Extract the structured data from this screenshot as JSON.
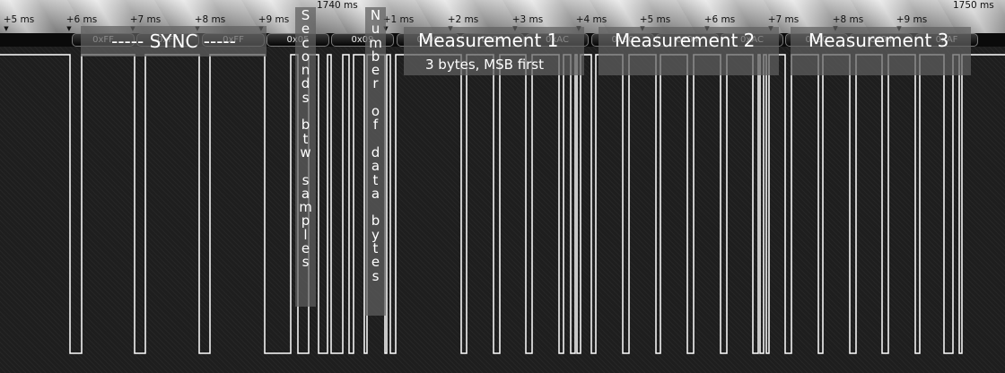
{
  "timeline": {
    "center_label": "1740 ms",
    "right_label": "1750 ms",
    "ticks": [
      "+5 ms",
      "+6 ms",
      "+7 ms",
      "+8 ms",
      "+9 ms",
      "+1 ms",
      "+2 ms",
      "+3 ms",
      "+4 ms",
      "+5 ms",
      "+6 ms",
      "+7 ms",
      "+8 ms",
      "+9 ms"
    ]
  },
  "decoded_bytes": [
    "0xFF",
    "0xFF",
    "0xFF",
    "0x05",
    "0x09",
    "0x00",
    "0x04",
    "0xAC",
    "0x00",
    "0x04",
    "0xAC",
    "0x00",
    "0x04",
    "0xAF"
  ],
  "annotations": {
    "sync": "----- SYNC -----",
    "seconds": [
      "S",
      "e",
      "c",
      "o",
      "n",
      "d",
      "s",
      "",
      "b",
      "t",
      "w",
      "",
      "s",
      "a",
      "m",
      "p",
      "l",
      "e",
      "s"
    ],
    "data_bytes": [
      "N",
      "u",
      "m",
      "b",
      "e",
      "r",
      "",
      "o",
      "f",
      "",
      "d",
      "a",
      "t",
      "a",
      "",
      "b",
      "y",
      "t",
      "e",
      "s"
    ],
    "measurement_1": "Measurement 1",
    "measurement_1_sub": "3 bytes, MSB first",
    "measurement_2": "Measurement 2",
    "measurement_3": "Measurement 3"
  },
  "colors": {
    "trace": "#ffffff",
    "background": "#1e1e1e",
    "annotation": "#5f5f5f"
  }
}
